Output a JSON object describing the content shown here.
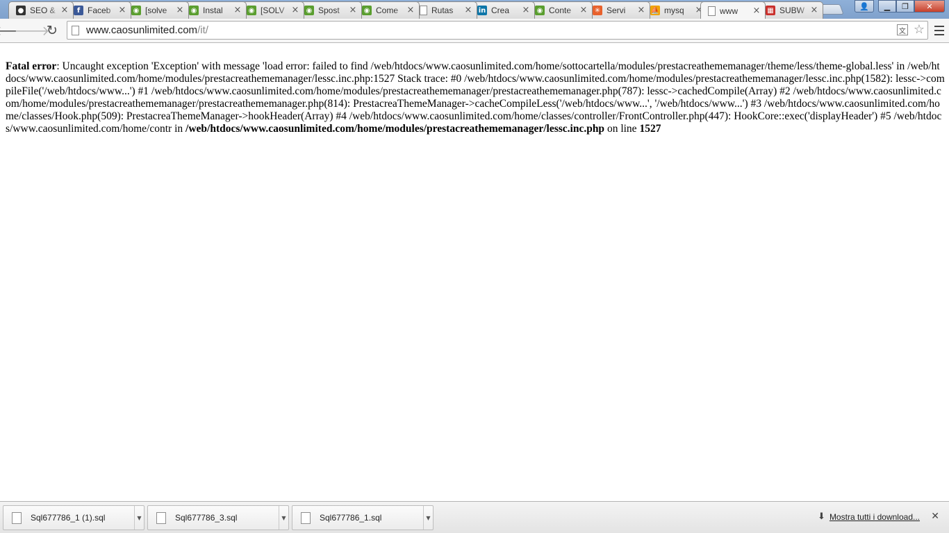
{
  "tabs": [
    {
      "title": "SEO &",
      "icon": "github-icon",
      "color": "#333333",
      "glyph": "●"
    },
    {
      "title": "Faceb",
      "icon": "facebook-icon",
      "color": "#3b5998",
      "glyph": "f"
    },
    {
      "title": "[solve",
      "icon": "prestashop-icon",
      "color": "#5a9e2f",
      "glyph": "◉"
    },
    {
      "title": "Instal",
      "icon": "prestashop-icon",
      "color": "#5a9e2f",
      "glyph": "◉"
    },
    {
      "title": "[SOLV",
      "icon": "prestashop-icon",
      "color": "#5a9e2f",
      "glyph": "◉"
    },
    {
      "title": "Spost",
      "icon": "prestashop-icon",
      "color": "#5a9e2f",
      "glyph": "◉"
    },
    {
      "title": "Come",
      "icon": "prestashop-icon",
      "color": "#5a9e2f",
      "glyph": "◉"
    },
    {
      "title": "Rutas",
      "icon": "page-icon",
      "color": "#bbbbbb",
      "glyph": ""
    },
    {
      "title": "Crea",
      "icon": "linkedin-icon",
      "color": "#0e76a8",
      "glyph": "in"
    },
    {
      "title": "Conte",
      "icon": "prestashop-icon",
      "color": "#5a9e2f",
      "glyph": "◉"
    },
    {
      "title": "Servi",
      "icon": "star-burst-icon",
      "color": "#e8612c",
      "glyph": "✳"
    },
    {
      "title": "mysq",
      "icon": "phpmyadmin-icon",
      "color": "#f0a30a",
      "glyph": "⛵"
    },
    {
      "title": "www",
      "icon": "page-icon",
      "color": "#bbbbbb",
      "glyph": "",
      "active": true
    },
    {
      "title": "SUBW",
      "icon": "subway-icon",
      "color": "#c9302c",
      "glyph": "▦"
    }
  ],
  "omnibox": {
    "url_host": "www.caosunlimited.com",
    "url_path": "/it/"
  },
  "error": {
    "label": "Fatal error",
    "message": ": Uncaught exception 'Exception' with message 'load error: failed to find /web/htdocs/www.caosunlimited.com/home/sottocartella/modules/prestacreathememanager/theme/less/theme-global.less' in /web/htdocs/www.caosunlimited.com/home/modules/prestacreathememanager/lessc.inc.php:1527 Stack trace: #0 /web/htdocs/www.caosunlimited.com/home/modules/prestacreathememanager/lessc.inc.php(1582): lessc->compileFile('/web/htdocs/www...') #1 /web/htdocs/www.caosunlimited.com/home/modules/prestacreathememanager/prestacreathememanager.php(787): lessc->cachedCompile(Array) #2 /web/htdocs/www.caosunlimited.com/home/modules/prestacreathememanager/prestacreathememanager.php(814): PrestacreaThemeManager->cacheCompileLess('/web/htdocs/www...', '/web/htdocs/www...') #3 /web/htdocs/www.caosunlimited.com/home/classes/Hook.php(509): PrestacreaThemeManager->hookHeader(Array) #4 /web/htdocs/www.caosunlimited.com/home/classes/controller/FrontController.php(447): HookCore::exec('displayHeader') #5 /web/htdocs/www.caosunlimited.com/home/contr in ",
    "file": "/web/htdocs/www.caosunlimited.com/home/modules/prestacreathememanager/lessc.inc.php",
    "on_line_text": " on line ",
    "line": "1527"
  },
  "downloads": [
    {
      "name": "Sql677786_1 (1).sql"
    },
    {
      "name": "Sql677786_3.sql"
    },
    {
      "name": "Sql677786_1.sql"
    }
  ],
  "download_shelf": {
    "show_all": "Mostra tutti i download..."
  }
}
